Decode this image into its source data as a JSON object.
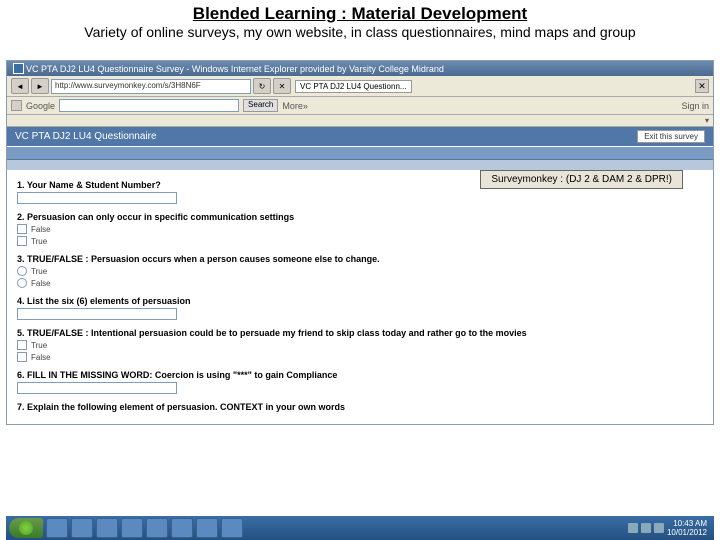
{
  "header": {
    "title": "Blended Learning : Material Development",
    "subtitle": "Variety of online surveys, my own website, in class questionnaires, mind maps and group"
  },
  "browser": {
    "title": "VC PTA DJ2 LU4 Questionnaire Survey - Windows Internet Explorer provided by Varsity College Midrand",
    "url": "http://www.surveymonkey.com/s/3H8N6F",
    "tab": "VC PTA DJ2 LU4 Questionn...",
    "google": "Google",
    "search_btn": "Search",
    "more": "More»",
    "signin": "Sign in"
  },
  "survey": {
    "title": "VC PTA DJ2 LU4 Questionnaire",
    "exit": "Exit this survey"
  },
  "callout": "Surveymonkey : (DJ 2 & DAM 2 & DPR!)",
  "q": {
    "q1": "1. Your Name & Student Number?",
    "q2": "2. Persuasion can only occur in specific communication settings",
    "q2a": "False",
    "q2b": "True",
    "q3": "3. TRUE/FALSE : Persuasion occurs when a person causes someone else to change.",
    "q3a": "True",
    "q3b": "False",
    "q4": "4. List the six (6) elements of persuasion",
    "q5": "5. TRUE/FALSE : Intentional persuasion could be to persuade my friend to skip class today and rather go to the movies",
    "q5a": "True",
    "q5b": "False",
    "q6": "6. FILL IN THE MISSING WORD: Coercion is using \"***\" to gain Compliance",
    "q7": "7. Explain the following element of persuasion. CONTEXT in your own words"
  },
  "tray": {
    "time": "10:43 AM",
    "date": "10/01/2012"
  }
}
